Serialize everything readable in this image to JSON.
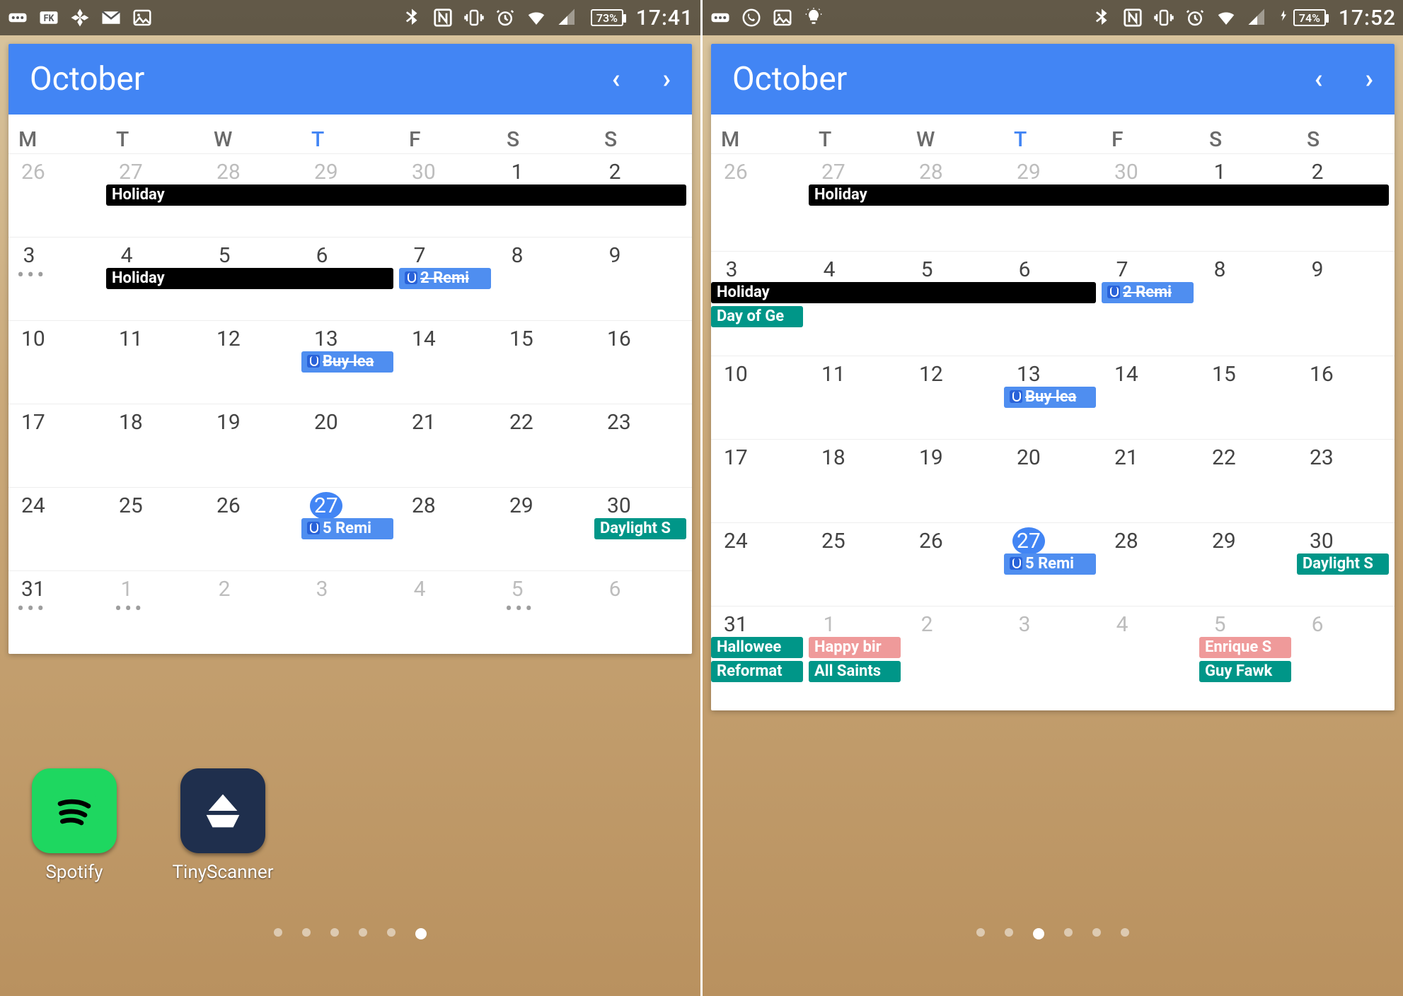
{
  "colors": {
    "accent": "#4285f4",
    "teal": "#009688",
    "salmon": "#ef9a9a",
    "black": "#000000"
  },
  "left": {
    "status": {
      "notif_icons": [
        "more-icon",
        "fk-icon",
        "photos-icon",
        "gmail-icon",
        "image-icon"
      ],
      "sys_icons": [
        "bluetooth-icon",
        "nfc-icon",
        "vibrate-icon",
        "alarm-icon",
        "wifi-icon",
        "signal-icon"
      ],
      "battery_pct": "73%",
      "charging": false,
      "time": "17:41"
    },
    "month": "October",
    "dow": [
      "M",
      "T",
      "W",
      "T",
      "F",
      "S",
      "S"
    ],
    "today_col": 3,
    "weeks": [
      {
        "days": [
          {
            "n": "26",
            "other": true
          },
          {
            "n": "27",
            "other": true
          },
          {
            "n": "28",
            "other": true
          },
          {
            "n": "29",
            "other": true
          },
          {
            "n": "30",
            "other": true
          },
          {
            "n": "1"
          },
          {
            "n": "2"
          }
        ],
        "chips": [
          {
            "text": "Holiday",
            "color": "black",
            "start": 1,
            "span": 6,
            "row": 0
          }
        ]
      },
      {
        "days": [
          {
            "n": "3",
            "dots": true
          },
          {
            "n": "4"
          },
          {
            "n": "5"
          },
          {
            "n": "6"
          },
          {
            "n": "7"
          },
          {
            "n": "8"
          },
          {
            "n": "9"
          }
        ],
        "chips": [
          {
            "text": "Holiday",
            "color": "black",
            "start": 1,
            "span": 3,
            "row": 0
          },
          {
            "text": "2 Remi",
            "color": "blue",
            "start": 4,
            "span": 1,
            "row": 0,
            "tap": true,
            "strike": true
          }
        ]
      },
      {
        "days": [
          {
            "n": "10"
          },
          {
            "n": "11"
          },
          {
            "n": "12"
          },
          {
            "n": "13"
          },
          {
            "n": "14"
          },
          {
            "n": "15"
          },
          {
            "n": "16"
          }
        ],
        "chips": [
          {
            "text": "Buy lea",
            "color": "blue",
            "start": 3,
            "span": 1,
            "row": 0,
            "tap": true,
            "strike": true
          }
        ]
      },
      {
        "days": [
          {
            "n": "17"
          },
          {
            "n": "18"
          },
          {
            "n": "19"
          },
          {
            "n": "20"
          },
          {
            "n": "21"
          },
          {
            "n": "22"
          },
          {
            "n": "23"
          }
        ],
        "chips": []
      },
      {
        "days": [
          {
            "n": "24"
          },
          {
            "n": "25"
          },
          {
            "n": "26"
          },
          {
            "n": "27",
            "today": true
          },
          {
            "n": "28"
          },
          {
            "n": "29"
          },
          {
            "n": "30"
          }
        ],
        "chips": [
          {
            "text": "5 Remi",
            "color": "blue",
            "start": 3,
            "span": 1,
            "row": 0,
            "tap": true
          },
          {
            "text": "Daylight S",
            "color": "teal",
            "start": 6,
            "span": 1,
            "row": 0
          }
        ]
      },
      {
        "days": [
          {
            "n": "31",
            "dots": true
          },
          {
            "n": "1",
            "other": true,
            "dots": true
          },
          {
            "n": "2",
            "other": true
          },
          {
            "n": "3",
            "other": true
          },
          {
            "n": "4",
            "other": true
          },
          {
            "n": "5",
            "other": true,
            "dots": true
          },
          {
            "n": "6",
            "other": true
          }
        ],
        "chips": []
      }
    ],
    "apps": [
      {
        "name": "spotify",
        "label": "Spotify"
      },
      {
        "name": "tiny",
        "label": "TinyScanner"
      }
    ],
    "pager_count": 6,
    "pager_active": 5
  },
  "right": {
    "status": {
      "notif_icons": [
        "more-icon",
        "whatsapp-icon",
        "image-icon",
        "bulb-icon"
      ],
      "sys_icons": [
        "bluetooth-icon",
        "nfc-icon",
        "vibrate-icon",
        "alarm-icon",
        "wifi-icon",
        "signal-icon"
      ],
      "battery_pct": "74%",
      "charging": true,
      "time": "17:52"
    },
    "month": "October",
    "dow": [
      "M",
      "T",
      "W",
      "T",
      "F",
      "S",
      "S"
    ],
    "today_col": 3,
    "weeks": [
      {
        "tall": "tallA",
        "days": [
          {
            "n": "26",
            "other": true
          },
          {
            "n": "27",
            "other": true
          },
          {
            "n": "28",
            "other": true
          },
          {
            "n": "29",
            "other": true
          },
          {
            "n": "30",
            "other": true
          },
          {
            "n": "1"
          },
          {
            "n": "2"
          }
        ],
        "chips": [
          {
            "text": "Holiday",
            "color": "black",
            "start": 1,
            "span": 6,
            "row": 0
          }
        ]
      },
      {
        "tall": "tallB",
        "days": [
          {
            "n": "3"
          },
          {
            "n": "4"
          },
          {
            "n": "5"
          },
          {
            "n": "6"
          },
          {
            "n": "7"
          },
          {
            "n": "8"
          },
          {
            "n": "9"
          }
        ],
        "chips": [
          {
            "text": "Holiday",
            "color": "black",
            "start": 0,
            "span": 4,
            "row": 0
          },
          {
            "text": "2 Remi",
            "color": "blue",
            "start": 4,
            "span": 1,
            "row": 0,
            "tap": true,
            "strike": true
          },
          {
            "text": "Day of Ge",
            "color": "teal",
            "start": 0,
            "span": 1,
            "row": 1
          }
        ]
      },
      {
        "days": [
          {
            "n": "10"
          },
          {
            "n": "11"
          },
          {
            "n": "12"
          },
          {
            "n": "13"
          },
          {
            "n": "14"
          },
          {
            "n": "15"
          },
          {
            "n": "16"
          }
        ],
        "chips": [
          {
            "text": "Buy lea",
            "color": "blue",
            "start": 3,
            "span": 1,
            "row": 0,
            "tap": true,
            "strike": true
          }
        ]
      },
      {
        "days": [
          {
            "n": "17"
          },
          {
            "n": "18"
          },
          {
            "n": "19"
          },
          {
            "n": "20"
          },
          {
            "n": "21"
          },
          {
            "n": "22"
          },
          {
            "n": "23"
          }
        ],
        "chips": []
      },
      {
        "days": [
          {
            "n": "24"
          },
          {
            "n": "25"
          },
          {
            "n": "26"
          },
          {
            "n": "27",
            "today": true
          },
          {
            "n": "28"
          },
          {
            "n": "29"
          },
          {
            "n": "30"
          }
        ],
        "chips": [
          {
            "text": "5 Remi",
            "color": "blue",
            "start": 3,
            "span": 1,
            "row": 0,
            "tap": true
          },
          {
            "text": "Daylight S",
            "color": "teal",
            "start": 6,
            "span": 1,
            "row": 0
          }
        ]
      },
      {
        "tall": "tallB",
        "days": [
          {
            "n": "31"
          },
          {
            "n": "1",
            "other": true
          },
          {
            "n": "2",
            "other": true
          },
          {
            "n": "3",
            "other": true
          },
          {
            "n": "4",
            "other": true
          },
          {
            "n": "5",
            "other": true
          },
          {
            "n": "6",
            "other": true
          }
        ],
        "chips": [
          {
            "text": "Hallowee",
            "color": "teal",
            "start": 0,
            "span": 1,
            "row": 0
          },
          {
            "text": "Happy bir",
            "color": "salmon",
            "start": 1,
            "span": 1,
            "row": 0
          },
          {
            "text": "Enrique S",
            "color": "salmon",
            "start": 5,
            "span": 1,
            "row": 0
          },
          {
            "text": "Reformat",
            "color": "teal",
            "start": 0,
            "span": 1,
            "row": 1
          },
          {
            "text": "All Saints",
            "color": "teal",
            "start": 1,
            "span": 1,
            "row": 1
          },
          {
            "text": "Guy Fawk",
            "color": "teal",
            "start": 5,
            "span": 1,
            "row": 1
          }
        ]
      }
    ],
    "pager_count": 6,
    "pager_active": 2
  }
}
